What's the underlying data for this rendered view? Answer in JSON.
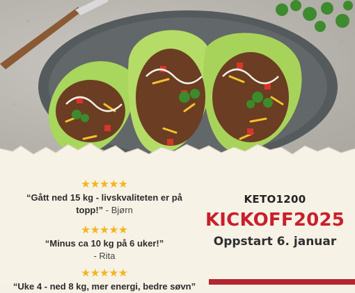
{
  "reviews": [
    {
      "stars": "★★★★★",
      "quote": "“Gått ned 15 kg - livskvaliteten er på topp!”",
      "author": "- Bjørn"
    },
    {
      "stars": "★★★★★",
      "quote": "“Minus ca 10 kg på 6 uker!”",
      "author": "- Rita"
    },
    {
      "stars": "★★★★★",
      "quote": "“Uke 4 - ned 8 kg, mer energi, bedre søvn”",
      "author": ""
    }
  ],
  "promo": {
    "program": "KETO1200",
    "campaign": "KICKOFF2025",
    "start": "Oppstart 6. januar"
  },
  "colors": {
    "accent_red": "#c8202c",
    "star_gold": "#f3b61f",
    "cream": "#f7f2e6"
  }
}
